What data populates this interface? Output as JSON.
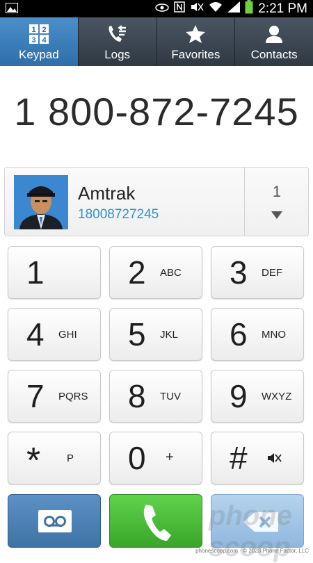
{
  "status_bar": {
    "time": "2:21 PM",
    "icons": [
      "picture-icon",
      "eye-icon",
      "nfc-icon",
      "mute-icon",
      "wifi-icon",
      "signal-icon",
      "battery-icon"
    ]
  },
  "tabs": [
    {
      "label": "Keypad",
      "icon": "keypad-icon",
      "active": true
    },
    {
      "label": "Logs",
      "icon": "call-logs-icon",
      "active": false
    },
    {
      "label": "Favorites",
      "icon": "star-icon",
      "active": false
    },
    {
      "label": "Contacts",
      "icon": "person-icon",
      "active": false
    }
  ],
  "dialed_number": "1 800-872-7245",
  "contact_match": {
    "name": "Amtrak",
    "number": "18008727245",
    "match_count": "1"
  },
  "keypad": [
    {
      "digit": "1",
      "letters": ""
    },
    {
      "digit": "2",
      "letters": "ABC"
    },
    {
      "digit": "3",
      "letters": "DEF"
    },
    {
      "digit": "4",
      "letters": "GHI"
    },
    {
      "digit": "5",
      "letters": "JKL"
    },
    {
      "digit": "6",
      "letters": "MNO"
    },
    {
      "digit": "7",
      "letters": "PQRS"
    },
    {
      "digit": "8",
      "letters": "TUV"
    },
    {
      "digit": "9",
      "letters": "WXYZ"
    },
    {
      "digit": "*",
      "letters": "P"
    },
    {
      "digit": "0",
      "letters": "+"
    },
    {
      "digit": "#",
      "letters": ""
    }
  ],
  "actions": {
    "voicemail_icon": "voicemail-icon",
    "call_icon": "phone-icon",
    "delete_icon": "backspace-icon"
  },
  "colors": {
    "active_tab": "#3b7fbd",
    "call_green": "#4cc23a",
    "number_link": "#2b93d3"
  },
  "watermark": {
    "brand": "phone scoop",
    "footer": "phonescoop.com · © 2023 Phone Factor, LLC"
  }
}
